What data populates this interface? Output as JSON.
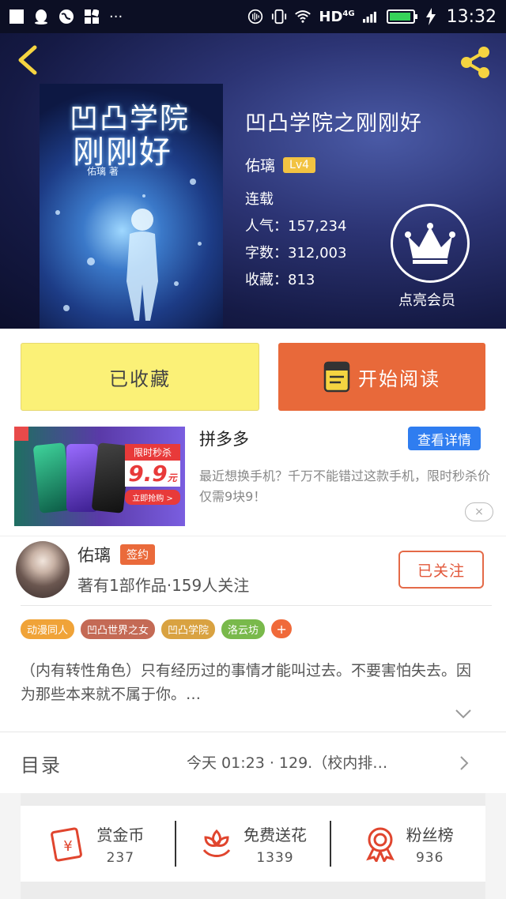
{
  "status_bar": {
    "network": "HD",
    "network_sub": "4G",
    "time": "13:32",
    "more": "···",
    "battery_level": 0.95
  },
  "book": {
    "title": "凹凸学院之刚刚好",
    "author": "佑璃",
    "level": "Lv4",
    "status": "连载",
    "popularity_label": "人气：",
    "popularity": "157,234",
    "words_label": "字数：",
    "words": "312,003",
    "collections_label": "收藏：",
    "collections": "813",
    "cover_title_line1": "凹凸学院",
    "cover_title_line2": "刚刚好",
    "cover_author": "佑璃 著"
  },
  "vip": {
    "label": "点亮会员"
  },
  "actions": {
    "collect": "已收藏",
    "read": "开始阅读"
  },
  "ad": {
    "name": "拼多多",
    "detail_button": "查看详情",
    "description": "最近想换手机？千万不能错过这款手机，限时秒杀价仅需9块9！",
    "sale_title": "限时秒杀",
    "sale_price": "9.9",
    "sale_unit": "元",
    "sale_button": "立即抢购 >",
    "close": "×"
  },
  "author_section": {
    "name": "佑璃",
    "badge": "签约",
    "works": "著有1部作品·159人关注",
    "follow_button": "已关注"
  },
  "tags": [
    {
      "label": "动漫同人",
      "color": "#f0a338"
    },
    {
      "label": "凹凸世界之女",
      "color": "#c46a55"
    },
    {
      "label": "凹凸学院",
      "color": "#d9a241"
    },
    {
      "label": "洛云坊",
      "color": "#79b94b"
    }
  ],
  "tag_add": "+",
  "intro": "（内有转性角色）只有经历过的事情才能叫过去。不要害怕失去。因为那些本来就不属于你。…",
  "toc": {
    "label": "目录",
    "latest": "今天 01:23 · 129.（校内排…"
  },
  "bottom": {
    "reward_label": "赏金币",
    "reward_count": "237",
    "flower_label": "免费送花",
    "flower_count": "1339",
    "fans_label": "粉丝榜",
    "fans_count": "936"
  },
  "colors": {
    "accent_orange": "#e8693a",
    "collect_yellow": "#fbf177",
    "ad_blue": "#2f7df0",
    "icon_red": "#e0452e",
    "lv_gold": "#f2c342"
  }
}
